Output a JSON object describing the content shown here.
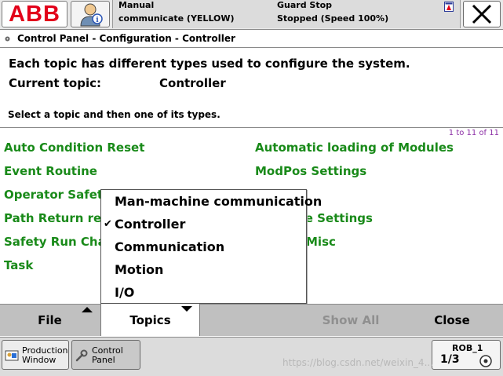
{
  "header": {
    "logo_text": "ABB",
    "mode": "Manual",
    "state": "communicate (YELLOW)",
    "guard": "Guard Stop",
    "speed": "Stopped (Speed 100%)"
  },
  "breadcrumb": "Control Panel - Configuration - Controller",
  "info": {
    "description": "Each topic has different types used to configure the system.",
    "current_topic_label": "Current topic:",
    "current_topic_value": "Controller",
    "hint": "Select a topic and then one of its types."
  },
  "types": {
    "counter": "1 to 11 of 11",
    "left": [
      "Auto Condition Reset",
      "Event Routine",
      "Operator Safety",
      "Path Return region",
      "Safety Run Chain",
      "Task"
    ],
    "right": [
      "Automatic loading of Modules",
      "ModPos Settings",
      "",
      "Run Mode Settings",
      "System Misc"
    ],
    "right_visible_tail": [
      "de Settings",
      "Misc"
    ]
  },
  "topics_menu": {
    "items": [
      "Man-machine communication",
      "Controller",
      "Communication",
      "Motion",
      "I/O"
    ],
    "checked": "Controller",
    "check_glyph": "✔"
  },
  "commandbar": {
    "file": "File",
    "topics": "Topics",
    "show_all": "Show All",
    "close": "Close"
  },
  "taskbar": {
    "production_window": "Production\nWindow",
    "control_panel": "Control\nPanel",
    "quickset_rob": "ROB_1",
    "quickset_fraction": "1/3"
  },
  "watermark": "https://blog.csdn.net/weixin_4...",
  "colors": {
    "brand_red": "#e2001a",
    "type_green": "#198a19",
    "counter_purple": "#8c2fa6",
    "disabled_gray": "#8f8f8f"
  }
}
